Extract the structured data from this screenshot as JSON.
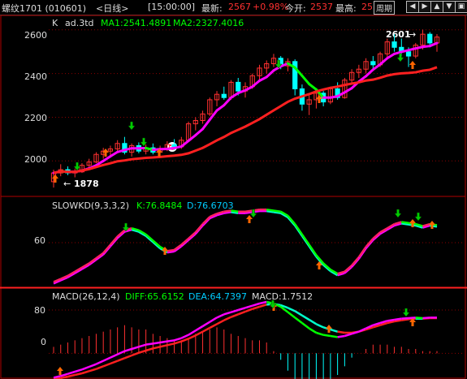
{
  "title_bar": {
    "symbol": "螺纹1701 (010601)",
    "period": "<日线>",
    "time": "[15:00:00]",
    "last_label": "最新:",
    "last_value": "2567",
    "change": "+0.98%",
    "open_label": "今开:",
    "open_value": "2537",
    "high_label": "最高:",
    "high_value": "25",
    "cycle_button": "周期",
    "buttons": [
      "left-arrow-icon",
      "right-arrow-icon",
      "up-arrow-icon",
      "down-arrow-icon",
      "maximize-icon"
    ]
  },
  "main_panel": {
    "legend_k": "K",
    "legend_ad": "ad.3td",
    "ma1": "MA1:2541.4891",
    "ma2": "MA2:2327.4016",
    "high_marker": "2601",
    "low_marker": "1878",
    "price_ticks": [
      "2600",
      "2400",
      "2200",
      "2000"
    ]
  },
  "kd_panel": {
    "label": "SLOWKD(9,3,3,2)",
    "k": "K:76.8484",
    "d": "D:76.6703",
    "ticks": [
      "60"
    ]
  },
  "macd_panel": {
    "label": "MACD(26,12,4)",
    "diff": "DIFF:65.6152",
    "dea": "DEA:64.7397",
    "macd": "MACD:1.7512",
    "ticks": [
      "80",
      "0"
    ]
  },
  "colors": {
    "up_candle": "#ff3030",
    "down_candle": "#00ffff",
    "ma_fast_up": "#ff00ff",
    "ma_fast_down": "#00ff00",
    "ma_slow": "#ff2020",
    "buy_arrow": "#ff6600",
    "sell_arrow": "#00cc00",
    "grid": "#8b0000"
  },
  "chart_data": {
    "type": "candlestick",
    "price_ylim": [
      1860,
      2640
    ],
    "candles": [
      {
        "o": 1905,
        "h": 1960,
        "l": 1878,
        "c": 1945
      },
      {
        "o": 1945,
        "h": 1985,
        "l": 1930,
        "c": 1960
      },
      {
        "o": 1960,
        "h": 1975,
        "l": 1935,
        "c": 1945
      },
      {
        "o": 1945,
        "h": 1965,
        "l": 1925,
        "c": 1950
      },
      {
        "o": 1950,
        "h": 1990,
        "l": 1945,
        "c": 1980
      },
      {
        "o": 1980,
        "h": 2010,
        "l": 1960,
        "c": 1995
      },
      {
        "o": 1995,
        "h": 2040,
        "l": 1990,
        "c": 2030
      },
      {
        "o": 2030,
        "h": 2060,
        "l": 2010,
        "c": 2045
      },
      {
        "o": 2045,
        "h": 2070,
        "l": 2020,
        "c": 2055
      },
      {
        "o": 2055,
        "h": 2095,
        "l": 2040,
        "c": 2080
      },
      {
        "o": 2080,
        "h": 2110,
        "l": 2030,
        "c": 2040
      },
      {
        "o": 2040,
        "h": 2080,
        "l": 2020,
        "c": 2070
      },
      {
        "o": 2070,
        "h": 2085,
        "l": 2035,
        "c": 2045
      },
      {
        "o": 2045,
        "h": 2075,
        "l": 2030,
        "c": 2060
      },
      {
        "o": 2060,
        "h": 2080,
        "l": 2030,
        "c": 2040
      },
      {
        "o": 2040,
        "h": 2070,
        "l": 2025,
        "c": 2055
      },
      {
        "o": 2055,
        "h": 2090,
        "l": 2045,
        "c": 2075
      },
      {
        "o": 2075,
        "h": 2100,
        "l": 2050,
        "c": 2065
      },
      {
        "o": 2065,
        "h": 2110,
        "l": 2055,
        "c": 2095
      },
      {
        "o": 2095,
        "h": 2180,
        "l": 2090,
        "c": 2170
      },
      {
        "o": 2170,
        "h": 2200,
        "l": 2140,
        "c": 2185
      },
      {
        "o": 2185,
        "h": 2230,
        "l": 2170,
        "c": 2215
      },
      {
        "o": 2215,
        "h": 2290,
        "l": 2205,
        "c": 2280
      },
      {
        "o": 2280,
        "h": 2320,
        "l": 2250,
        "c": 2305
      },
      {
        "o": 2305,
        "h": 2340,
        "l": 2280,
        "c": 2290
      },
      {
        "o": 2290,
        "h": 2370,
        "l": 2280,
        "c": 2360
      },
      {
        "o": 2360,
        "h": 2380,
        "l": 2300,
        "c": 2320
      },
      {
        "o": 2320,
        "h": 2360,
        "l": 2290,
        "c": 2340
      },
      {
        "o": 2340,
        "h": 2400,
        "l": 2330,
        "c": 2390
      },
      {
        "o": 2390,
        "h": 2440,
        "l": 2370,
        "c": 2425
      },
      {
        "o": 2425,
        "h": 2460,
        "l": 2400,
        "c": 2445
      },
      {
        "o": 2445,
        "h": 2490,
        "l": 2430,
        "c": 2470
      },
      {
        "o": 2470,
        "h": 2480,
        "l": 2420,
        "c": 2435
      },
      {
        "o": 2435,
        "h": 2470,
        "l": 2410,
        "c": 2455
      },
      {
        "o": 2455,
        "h": 2465,
        "l": 2300,
        "c": 2330
      },
      {
        "o": 2330,
        "h": 2350,
        "l": 2230,
        "c": 2260
      },
      {
        "o": 2260,
        "h": 2300,
        "l": 2210,
        "c": 2280
      },
      {
        "o": 2280,
        "h": 2330,
        "l": 2240,
        "c": 2310
      },
      {
        "o": 2310,
        "h": 2320,
        "l": 2250,
        "c": 2270
      },
      {
        "o": 2270,
        "h": 2340,
        "l": 2260,
        "c": 2330
      },
      {
        "o": 2330,
        "h": 2360,
        "l": 2280,
        "c": 2290
      },
      {
        "o": 2290,
        "h": 2380,
        "l": 2285,
        "c": 2370
      },
      {
        "o": 2370,
        "h": 2420,
        "l": 2350,
        "c": 2405
      },
      {
        "o": 2405,
        "h": 2440,
        "l": 2380,
        "c": 2420
      },
      {
        "o": 2420,
        "h": 2470,
        "l": 2400,
        "c": 2455
      },
      {
        "o": 2455,
        "h": 2480,
        "l": 2420,
        "c": 2440
      },
      {
        "o": 2440,
        "h": 2500,
        "l": 2430,
        "c": 2490
      },
      {
        "o": 2490,
        "h": 2560,
        "l": 2470,
        "c": 2545
      },
      {
        "o": 2545,
        "h": 2580,
        "l": 2500,
        "c": 2520
      },
      {
        "o": 2520,
        "h": 2560,
        "l": 2480,
        "c": 2500
      },
      {
        "o": 2500,
        "h": 2520,
        "l": 2430,
        "c": 2480
      },
      {
        "o": 2480,
        "h": 2540,
        "l": 2470,
        "c": 2530
      },
      {
        "o": 2530,
        "h": 2601,
        "l": 2510,
        "c": 2580
      },
      {
        "o": 2580,
        "h": 2590,
        "l": 2520,
        "c": 2540
      },
      {
        "o": 2540,
        "h": 2580,
        "l": 2500,
        "c": 2567
      }
    ],
    "kd_ylim": [
      20,
      100
    ],
    "k_line": [
      22,
      25,
      28,
      32,
      36,
      40,
      45,
      50,
      58,
      66,
      72,
      74,
      72,
      68,
      62,
      56,
      52,
      53,
      58,
      64,
      70,
      78,
      85,
      88,
      90,
      91,
      90,
      90,
      91,
      92,
      92,
      91,
      90,
      86,
      78,
      68,
      58,
      48,
      40,
      34,
      30,
      32,
      38,
      46,
      56,
      64,
      70,
      74,
      78,
      80,
      79,
      78,
      76,
      78,
      77
    ],
    "macd_ylim": [
      -40,
      110
    ],
    "diff_line": [
      -45,
      -42,
      -38,
      -34,
      -30,
      -25,
      -20,
      -14,
      -8,
      -2,
      4,
      8,
      12,
      16,
      18,
      20,
      22,
      24,
      28,
      34,
      42,
      50,
      58,
      66,
      72,
      76,
      80,
      84,
      88,
      92,
      95,
      92,
      86,
      76,
      66,
      56,
      46,
      38,
      34,
      32,
      30,
      32,
      36,
      40,
      46,
      52,
      56,
      60,
      62,
      64,
      65,
      66,
      65,
      66,
      66
    ],
    "dea_line": [
      -48,
      -46,
      -43,
      -40,
      -37,
      -33,
      -29,
      -24,
      -19,
      -14,
      -9,
      -4,
      1,
      5,
      9,
      12,
      15,
      18,
      22,
      27,
      33,
      40,
      47,
      54,
      61,
      67,
      72,
      77,
      82,
      86,
      90,
      91,
      89,
      84,
      78,
      70,
      62,
      54,
      48,
      44,
      40,
      38,
      38,
      40,
      44,
      48,
      52,
      56,
      59,
      61,
      63,
      64,
      64,
      65,
      65
    ]
  }
}
